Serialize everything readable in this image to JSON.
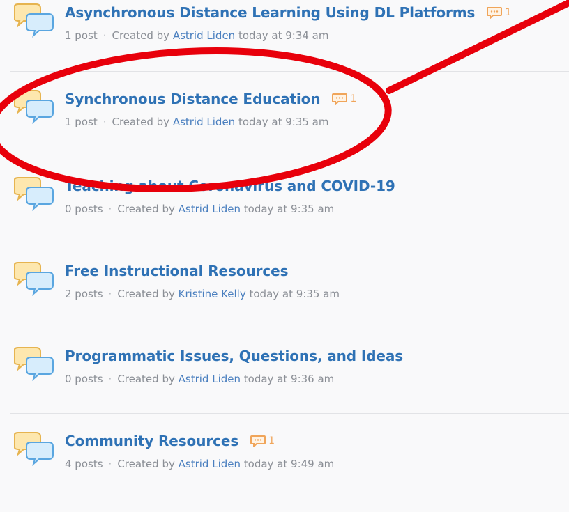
{
  "topics": [
    {
      "title": "Asynchronous Distance Learning Using DL Platforms",
      "badge": "1",
      "posts": "1 post",
      "created": "Created by",
      "author": "Astrid Liden",
      "time": "today at 9:34 am"
    },
    {
      "title": "Synchronous Distance Education",
      "badge": "1",
      "posts": "1 post",
      "created": "Created by",
      "author": "Astrid Liden",
      "time": "today at 9:35 am"
    },
    {
      "title": "Teaching about Coronavirus and COVID-19",
      "badge": "",
      "posts": "0 posts",
      "created": "Created by",
      "author": "Astrid Liden",
      "time": "today at 9:35 am"
    },
    {
      "title": "Free Instructional Resources",
      "badge": "",
      "posts": "2 posts",
      "created": "Created by",
      "author": "Kristine Kelly",
      "time": "today at 9:35 am"
    },
    {
      "title": "Programmatic Issues, Questions, and Ideas",
      "badge": "",
      "posts": "0 posts",
      "created": "Created by",
      "author": "Astrid Liden",
      "time": "today at 9:36 am"
    },
    {
      "title": "Community Resources",
      "badge": "1",
      "posts": "4 posts",
      "created": "Created by",
      "author": "Astrid Liden",
      "time": "today at 9:49 am"
    }
  ],
  "meta_separator": "·",
  "colors": {
    "title": "#2f72b5",
    "author": "#4a7fbf",
    "meta": "#8b8f96",
    "badge": "#f0a55a",
    "annotation": "#e8000b",
    "background": "#f9f9fa"
  },
  "icons": {
    "forum": "discussion-bubbles-icon",
    "badge": "comment-icon"
  }
}
